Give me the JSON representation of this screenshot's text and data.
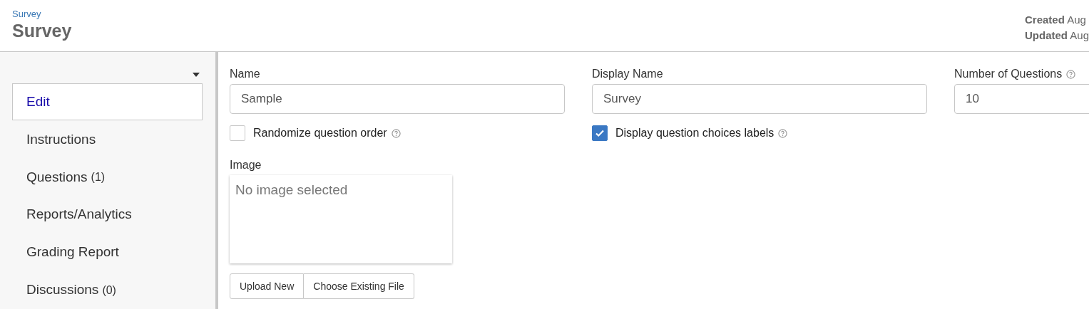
{
  "header": {
    "breadcrumb": "Survey",
    "title": "Survey",
    "created": "**Created** Aug",
    "updated": "**Updated** Aug"
  },
  "sidebar": {
    "items": [
      {
        "label": "Edit",
        "selected": true
      },
      {
        "label": "Instructions",
        "selected": false
      },
      {
        "label": "Questions",
        "count": "(1)",
        "selected": false
      },
      {
        "label": "Reports/Analytics",
        "selected": false
      },
      {
        "label": "Grading Report",
        "selected": false
      },
      {
        "label": "Discussions",
        "count": "(0)",
        "selected": false
      }
    ]
  },
  "form": {
    "name": {
      "label": "Name",
      "value": "Sample"
    },
    "display_name": {
      "label": "Display Name",
      "value": "Survey"
    },
    "number_of_questions": {
      "label": "Number of Questions",
      "value": "10"
    },
    "checkboxes": [
      {
        "label": "Randomize question order",
        "checked": false
      },
      {
        "label": "Display question choices labels",
        "checked": true
      }
    ],
    "image": {
      "label": "Image",
      "placeholder": "No image selected",
      "buttons": [
        "Upload New",
        "Choose Existing File"
      ]
    }
  }
}
